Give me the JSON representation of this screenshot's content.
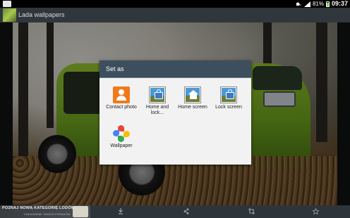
{
  "status_bar": {
    "battery_percent": "81%",
    "time": "09:37"
  },
  "action_bar": {
    "title": "Lada wallpapers",
    "app_icon": "app-icon-car"
  },
  "dialog": {
    "title": "Set as",
    "options": [
      {
        "label": "Contact photo",
        "icon": "contact-icon"
      },
      {
        "label": "Home and lock...",
        "icon": "home-and-lock-icon"
      },
      {
        "label": "Home screen",
        "icon": "home-screen-icon"
      },
      {
        "label": "Lock screen",
        "icon": "lock-screen-icon"
      },
      {
        "label": "Wallpaper",
        "icon": "wallpaper-icon"
      }
    ],
    "header_color": "#3d4f5e"
  },
  "ad_banner": {
    "headline": "POZNAJ NOWĄ KATEGORIĘ LODÓWEK",
    "subline": "CHŁODZENIE TWOICH POSIŁKÓW"
  },
  "bottom_bar": {
    "buttons": [
      "download-icon",
      "share-icon",
      "crop-icon",
      "star-icon"
    ]
  }
}
